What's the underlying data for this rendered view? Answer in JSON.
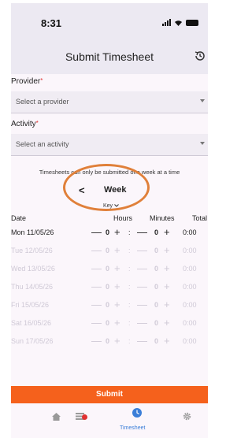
{
  "status_bar": {
    "time": "8:31"
  },
  "header": {
    "title": "Submit Timesheet",
    "history_icon": "history-icon"
  },
  "form": {
    "provider": {
      "label": "Provider",
      "required_mark": "*",
      "placeholder": "Select a provider"
    },
    "activity": {
      "label": "Activity",
      "required_mark": "*",
      "placeholder": "Select an activity"
    }
  },
  "notice": "Timesheets can only be submitted one week at a time",
  "week": {
    "prev_icon": "<",
    "label": "Week"
  },
  "key": {
    "label": "Key",
    "icon": "chevron-down-icon"
  },
  "table": {
    "columns": {
      "date": "Date",
      "hours": "Hours",
      "minutes": "Minutes",
      "total": "Total"
    },
    "rows": [
      {
        "date": "Mon 11/05/26",
        "hours": "0",
        "minutes": "0",
        "total": "0:00",
        "enabled": true
      },
      {
        "date": "Tue 12/05/26",
        "hours": "0",
        "minutes": "0",
        "total": "0:00",
        "enabled": false
      },
      {
        "date": "Wed 13/05/26",
        "hours": "0",
        "minutes": "0",
        "total": "0:00",
        "enabled": false
      },
      {
        "date": "Thu 14/05/26",
        "hours": "0",
        "minutes": "0",
        "total": "0:00",
        "enabled": false
      },
      {
        "date": "Fri 15/05/26",
        "hours": "0",
        "minutes": "0",
        "total": "0:00",
        "enabled": false
      },
      {
        "date": "Sat 16/05/26",
        "hours": "0",
        "minutes": "0",
        "total": "0:00",
        "enabled": false
      },
      {
        "date": "Sun 17/05/26",
        "hours": "0",
        "minutes": "0",
        "total": "0:00",
        "enabled": false
      }
    ],
    "minus": "—",
    "plus": "+",
    "separator": ":"
  },
  "submit_label": "Submit",
  "bottom_nav": {
    "items": [
      {
        "icon": "home-icon",
        "label": ""
      },
      {
        "icon": "list-icon",
        "label": ""
      },
      {
        "icon": "clock-icon",
        "label": "Timesheet"
      },
      {
        "icon": "gear-icon",
        "label": ""
      }
    ],
    "active": "Timesheet"
  },
  "colors": {
    "accent": "#f5611c",
    "nav_active": "#3b7ed8",
    "highlight_ring": "#e0803a",
    "required": "#e03131"
  }
}
